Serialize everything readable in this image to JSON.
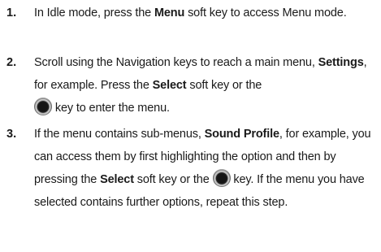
{
  "steps": [
    {
      "number": "1.",
      "segments": {
        "t1": "In Idle mode, press the ",
        "b1": "Menu",
        "t2": " soft key to access Menu mode."
      }
    },
    {
      "number": "2.",
      "segments": {
        "t1": "Scroll using the Navigation keys to reach a main menu, ",
        "b1": "Settings",
        "t2": ", for example. Press the ",
        "b2": "Select",
        "t3": " soft key or the ",
        "t4": " key to enter the menu."
      },
      "icons": [
        "select-key-icon"
      ]
    },
    {
      "number": "3.",
      "segments": {
        "t1": "If the menu contains sub-menus, ",
        "b1": "Sound Profile",
        "t2": ", for example, you can access them by first highlighting the option and then by pressing the ",
        "b2": "Select",
        "t3": " soft key or the ",
        "t4": " key. If the menu you have selected contains further options, repeat this step."
      },
      "icons": [
        "select-key-icon"
      ]
    }
  ]
}
